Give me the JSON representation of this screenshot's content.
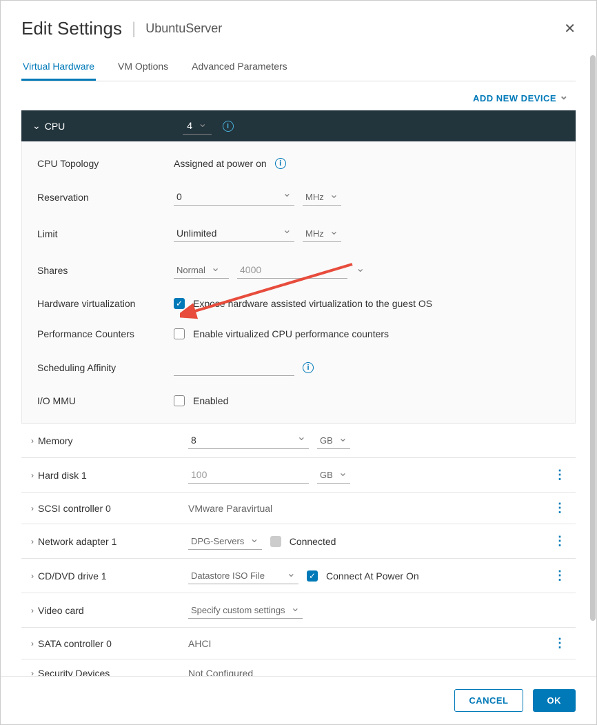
{
  "header": {
    "title": "Edit Settings",
    "subtitle": "UbuntuServer"
  },
  "tabs": {
    "items": [
      "Virtual Hardware",
      "VM Options",
      "Advanced Parameters"
    ],
    "active": 0
  },
  "add_device_label": "ADD NEW DEVICE",
  "cpu": {
    "label": "CPU",
    "value": "4",
    "topology": {
      "label": "CPU Topology",
      "value": "Assigned at power on"
    },
    "reservation": {
      "label": "Reservation",
      "value": "0",
      "unit": "MHz"
    },
    "limit": {
      "label": "Limit",
      "value": "Unlimited",
      "unit": "MHz"
    },
    "shares": {
      "label": "Shares",
      "level": "Normal",
      "value": "4000"
    },
    "hw_virt": {
      "label": "Hardware virtualization",
      "checkbox_label": "Expose hardware assisted virtualization to the guest OS",
      "checked": true
    },
    "perf_counters": {
      "label": "Performance Counters",
      "checkbox_label": "Enable virtualized CPU performance counters",
      "checked": false
    },
    "sched_affinity": {
      "label": "Scheduling Affinity",
      "value": ""
    },
    "io_mmu": {
      "label": "I/O MMU",
      "checkbox_label": "Enabled",
      "checked": false
    }
  },
  "devices": {
    "memory": {
      "label": "Memory",
      "value": "8",
      "unit": "GB"
    },
    "hard_disk": {
      "label": "Hard disk 1",
      "value": "100",
      "unit": "GB"
    },
    "scsi": {
      "label": "SCSI controller 0",
      "value": "VMware Paravirtual"
    },
    "network": {
      "label": "Network adapter 1",
      "value": "DPG-Servers",
      "connected_label": "Connected"
    },
    "cddvd": {
      "label": "CD/DVD drive 1",
      "value": "Datastore ISO File",
      "connect_label": "Connect At Power On",
      "connect_checked": true
    },
    "video": {
      "label": "Video card",
      "value": "Specify custom settings"
    },
    "sata": {
      "label": "SATA controller 0",
      "value": "AHCI"
    },
    "security": {
      "label": "Security Devices",
      "value": "Not Configured"
    }
  },
  "footer": {
    "cancel": "CANCEL",
    "ok": "OK"
  }
}
